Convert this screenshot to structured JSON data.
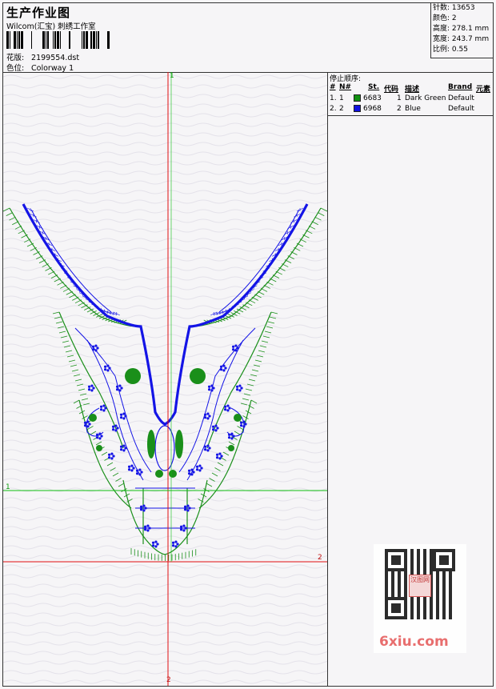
{
  "header": {
    "title": "生产作业图",
    "company": "Wilcom(汇宝) 刺绣工作室",
    "design_label": "花版:",
    "design_value": "2199554.dst",
    "colorway_label": "色位:",
    "colorway_value": "Colorway 1"
  },
  "stats": [
    {
      "label": "针数:",
      "value": "13653"
    },
    {
      "label": "颜色:",
      "value": "2"
    },
    {
      "label": "高度:",
      "value": "278.1 mm"
    },
    {
      "label": "宽度:",
      "value": "243.7 mm"
    },
    {
      "label": "比例:",
      "value": "0.55"
    }
  ],
  "stop_panel": {
    "title": "停止顺序:",
    "columns": [
      "#",
      "N#",
      "St.",
      "代码",
      "描述",
      "Brand",
      "元素"
    ],
    "rows": [
      {
        "num": "1.",
        "n": "1",
        "color": "#119111",
        "st": "6683",
        "code": "1",
        "desc": "Dark Green",
        "brand": "Default"
      },
      {
        "num": "2.",
        "n": "2",
        "color": "#1010e0",
        "st": "6968",
        "code": "2",
        "desc": "Blue",
        "brand": "Default"
      }
    ]
  },
  "canvas": {
    "axis_labels": {
      "top": "1",
      "left": "1",
      "right": "2",
      "bottom": "2"
    },
    "colors": {
      "green": "#1a8f1a",
      "blue": "#1414e6",
      "axis_red": "#e01010",
      "axis_green": "#10c010"
    }
  },
  "watermark": {
    "text": "6xiu.com",
    "stamp": "汉图网"
  }
}
